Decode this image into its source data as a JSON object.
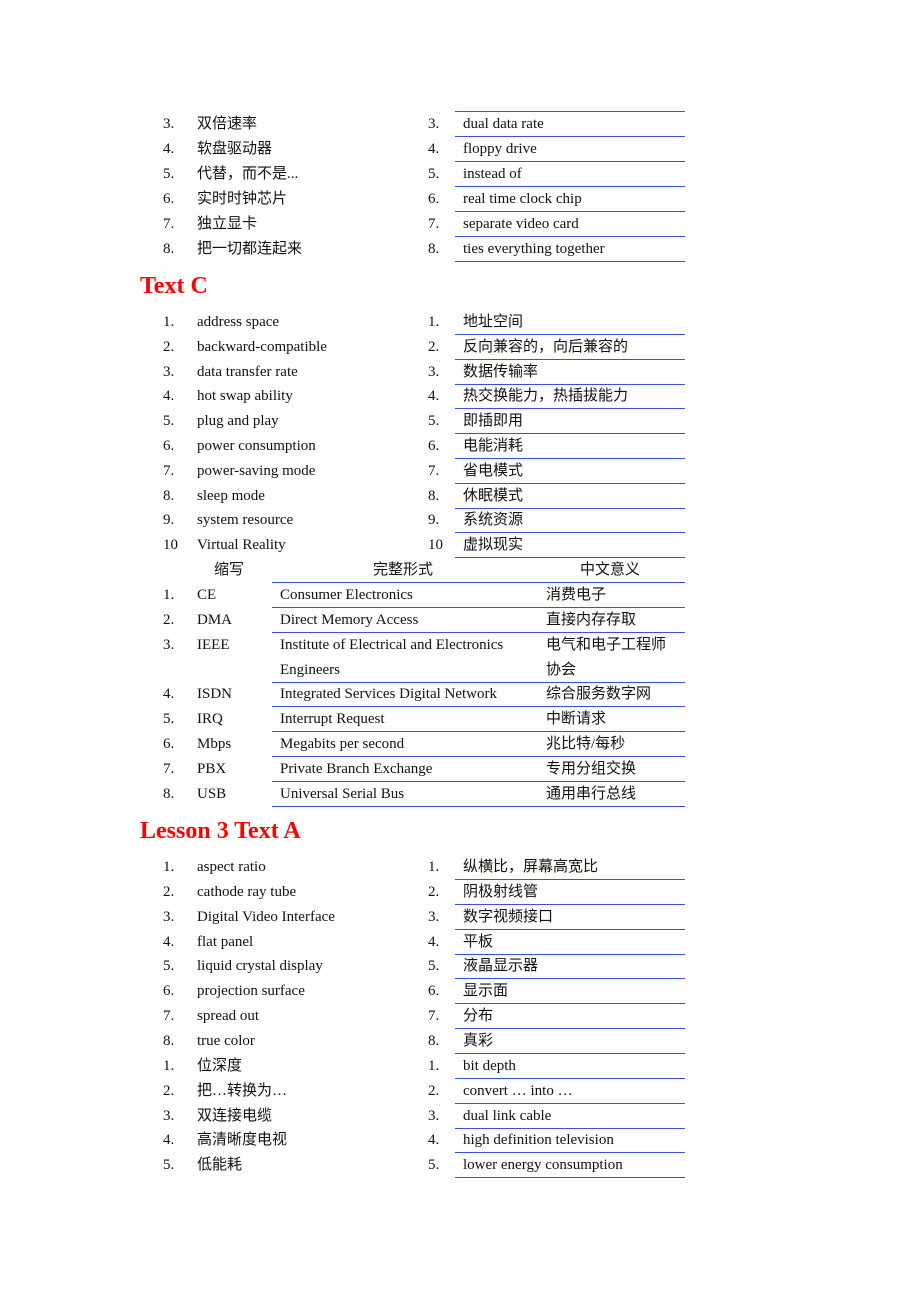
{
  "section_top": {
    "left_items": [
      {
        "num": "3.",
        "text": "双倍速率"
      },
      {
        "num": "4.",
        "text": "软盘驱动器"
      },
      {
        "num": "5.",
        "text": "代替，而不是..."
      },
      {
        "num": "6.",
        "text": "实时时钟芯片"
      },
      {
        "num": "7.",
        "text": "独立显卡"
      },
      {
        "num": "8.",
        "text": "把一切都连起来"
      }
    ],
    "right_items": [
      {
        "num": "3.",
        "text": "dual data rate"
      },
      {
        "num": "4.",
        "text": "floppy drive"
      },
      {
        "num": "5.",
        "text": "instead of"
      },
      {
        "num": "6.",
        "text": "real time clock chip"
      },
      {
        "num": "7.",
        "text": "separate video card"
      },
      {
        "num": "8.",
        "text": "ties everything together"
      }
    ]
  },
  "text_c": {
    "heading": "Text C",
    "left_items": [
      {
        "num": "1.",
        "text": "address space"
      },
      {
        "num": "2.",
        "text": "backward-compatible"
      },
      {
        "num": "3.",
        "text": "data transfer rate"
      },
      {
        "num": "4.",
        "text": "hot swap ability"
      },
      {
        "num": "5.",
        "text": "plug and play"
      },
      {
        "num": "6.",
        "text": "power consumption"
      },
      {
        "num": "7.",
        "text": "power-saving mode"
      },
      {
        "num": "8.",
        "text": "sleep mode"
      },
      {
        "num": "9.",
        "text": "system resource"
      },
      {
        "num": "10",
        "text": "Virtual Reality"
      }
    ],
    "right_items": [
      {
        "num": "1.",
        "text": "地址空间"
      },
      {
        "num": "2.",
        "text": "反向兼容的，向后兼容的"
      },
      {
        "num": "3.",
        "text": "数据传输率"
      },
      {
        "num": "4.",
        "text": "热交换能力，热插拔能力"
      },
      {
        "num": "5.",
        "text": "即插即用"
      },
      {
        "num": "6.",
        "text": "电能消耗"
      },
      {
        "num": "7.",
        "text": "省电模式"
      },
      {
        "num": "8.",
        "text": "休眠模式"
      },
      {
        "num": "9.",
        "text": "系统资源"
      },
      {
        "num": "10",
        "text": "虚拟现实"
      }
    ],
    "abbr_table": {
      "headers": [
        "缩写",
        "完整形式",
        "中文意义"
      ],
      "rows": [
        {
          "num": "1.",
          "abbr": "CE",
          "full": "Consumer Electronics",
          "cn": "消费电子"
        },
        {
          "num": "2.",
          "abbr": "DMA",
          "full": "Direct Memory Access",
          "cn": "直接内存存取"
        },
        {
          "num": "3.",
          "abbr": "IEEE",
          "full": "Institute of Electrical and Electronics",
          "full2": "Engineers",
          "cn": "电气和电子工程师",
          "cn2": "协会"
        },
        {
          "num": "4.",
          "abbr": "ISDN",
          "full": "Integrated Services Digital Network",
          "cn": "综合服务数字网"
        },
        {
          "num": "5.",
          "abbr": "IRQ",
          "full": "Interrupt Request",
          "cn": "中断请求"
        },
        {
          "num": "6.",
          "abbr": "Mbps",
          "full": "Megabits per second",
          "cn": "兆比特/每秒"
        },
        {
          "num": "7.",
          "abbr": "PBX",
          "full": "Private Branch Exchange",
          "cn": "专用分组交换"
        },
        {
          "num": "8.",
          "abbr": "USB",
          "full": "Universal Serial Bus",
          "cn": "通用串行总线"
        }
      ]
    }
  },
  "lesson3": {
    "heading": "Lesson 3 Text A",
    "left_items": [
      {
        "num": "1.",
        "text": "aspect ratio"
      },
      {
        "num": "2.",
        "text": "cathode ray tube"
      },
      {
        "num": "3.",
        "text": "Digital Video Interface"
      },
      {
        "num": "4.",
        "text": "flat panel"
      },
      {
        "num": "5.",
        "text": "liquid crystal display"
      },
      {
        "num": "6.",
        "text": "projection surface"
      },
      {
        "num": "7.",
        "text": "spread out"
      },
      {
        "num": "8.",
        "text": "true color"
      },
      {
        "num": "1.",
        "text": "位深度"
      },
      {
        "num": "2.",
        "text": "把…转换为…"
      },
      {
        "num": "3.",
        "text": "双连接电缆"
      },
      {
        "num": "4.",
        "text": "高清晰度电视"
      },
      {
        "num": "5.",
        "text": "低能耗"
      }
    ],
    "right_items": [
      {
        "num": "1.",
        "text": "纵横比，屏幕高宽比"
      },
      {
        "num": "2.",
        "text": "阴极射线管"
      },
      {
        "num": "3.",
        "text": "数字视频接口"
      },
      {
        "num": "4.",
        "text": "平板"
      },
      {
        "num": "5.",
        "text": "液晶显示器"
      },
      {
        "num": "6.",
        "text": "显示面"
      },
      {
        "num": "7.",
        "text": "分布"
      },
      {
        "num": "8.",
        "text": "真彩"
      },
      {
        "num": "1.",
        "text": "bit depth"
      },
      {
        "num": "2.",
        "text": "convert … into …"
      },
      {
        "num": "3.",
        "text": "dual link cable"
      },
      {
        "num": "4.",
        "text": "high definition television"
      },
      {
        "num": "5.",
        "text": "lower energy consumption"
      }
    ]
  },
  "colors": {
    "heading": "#ff0000",
    "underline": "#3a4fe0"
  }
}
